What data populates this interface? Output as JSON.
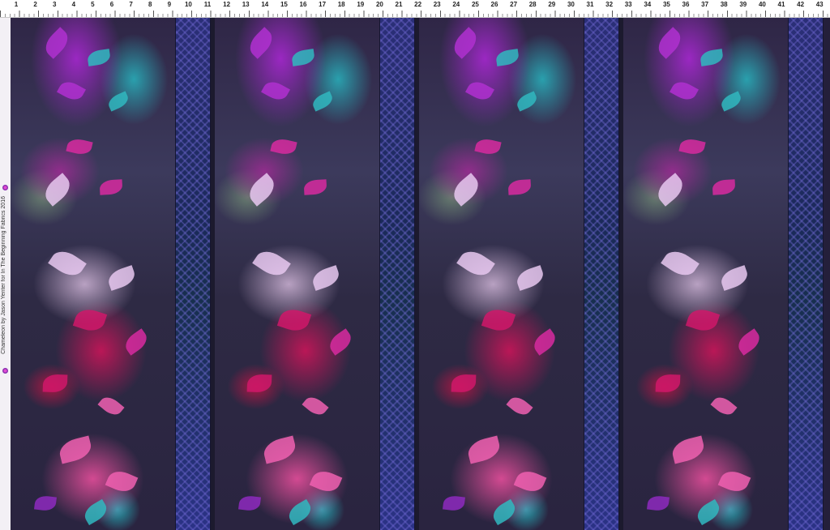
{
  "ruler": {
    "marks": [
      "1",
      "2",
      "3",
      "4",
      "5",
      "6",
      "7",
      "8",
      "9",
      "10",
      "11",
      "12",
      "13",
      "14",
      "15",
      "16",
      "17",
      "18",
      "19",
      "20",
      "21",
      "22",
      "23",
      "24",
      "25",
      "26",
      "27",
      "28",
      "29",
      "30",
      "31",
      "32",
      "33",
      "34",
      "35",
      "36",
      "37",
      "38",
      "39",
      "40",
      "41",
      "42",
      "43"
    ]
  },
  "selvage": {
    "text": "Chameleon by Jason Yenter for In The Beginning Fabrics 2016"
  },
  "fabric": {
    "panel_count": 4,
    "colors": {
      "background": "#241f3a",
      "purple": "#a028c8",
      "teal": "#28b4be",
      "magenta": "#d2145a",
      "pink": "#f050a0",
      "lavender": "#e6c8eb",
      "stripe_blue": "#2b2f78"
    }
  }
}
